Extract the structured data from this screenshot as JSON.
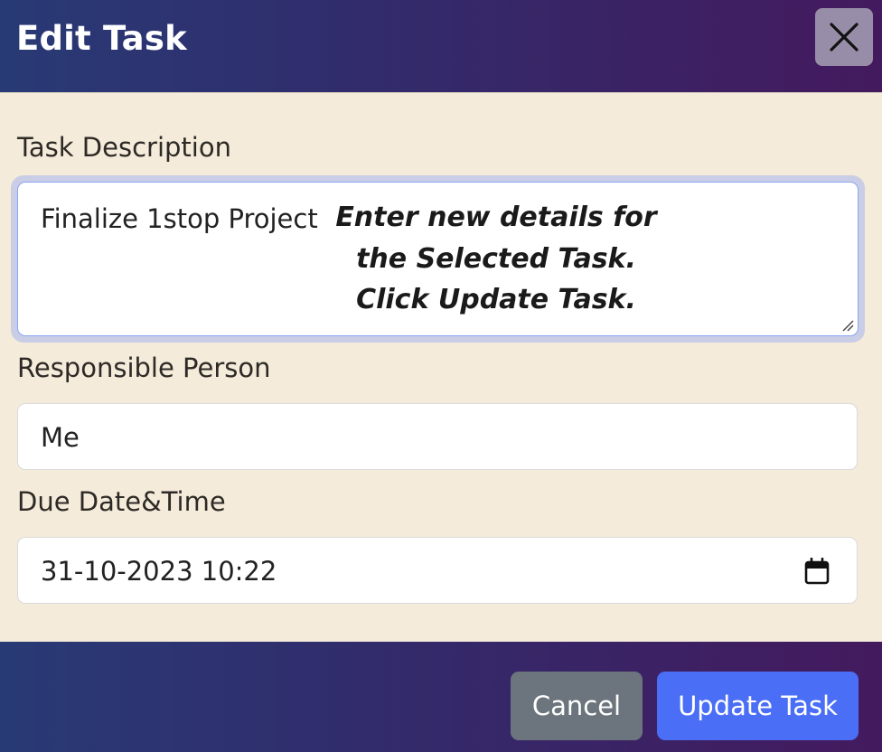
{
  "dialog": {
    "title": "Edit Task"
  },
  "form": {
    "description_label": "Task Description",
    "description_value": "Finalize 1stop Project",
    "instruction_lines": [
      "Enter new details for",
      "the Selected Task.",
      "Click Update Task."
    ],
    "responsible_label": "Responsible Person",
    "responsible_value": "Me",
    "due_label": "Due Date&Time",
    "due_value": "31-10-2023 10:22"
  },
  "footer": {
    "cancel_label": "Cancel",
    "update_label": "Update Task"
  },
  "icons": {
    "close": "close-icon",
    "calendar": "calendar-icon",
    "resize": "resize-handle-icon"
  },
  "colors": {
    "header_gradient_start": "#283a75",
    "header_gradient_end": "#441a5e",
    "body_background": "#f5ebda",
    "cancel_button": "#6c757d",
    "update_button": "#4a6ef5",
    "focus_border": "#8ba6f2"
  }
}
